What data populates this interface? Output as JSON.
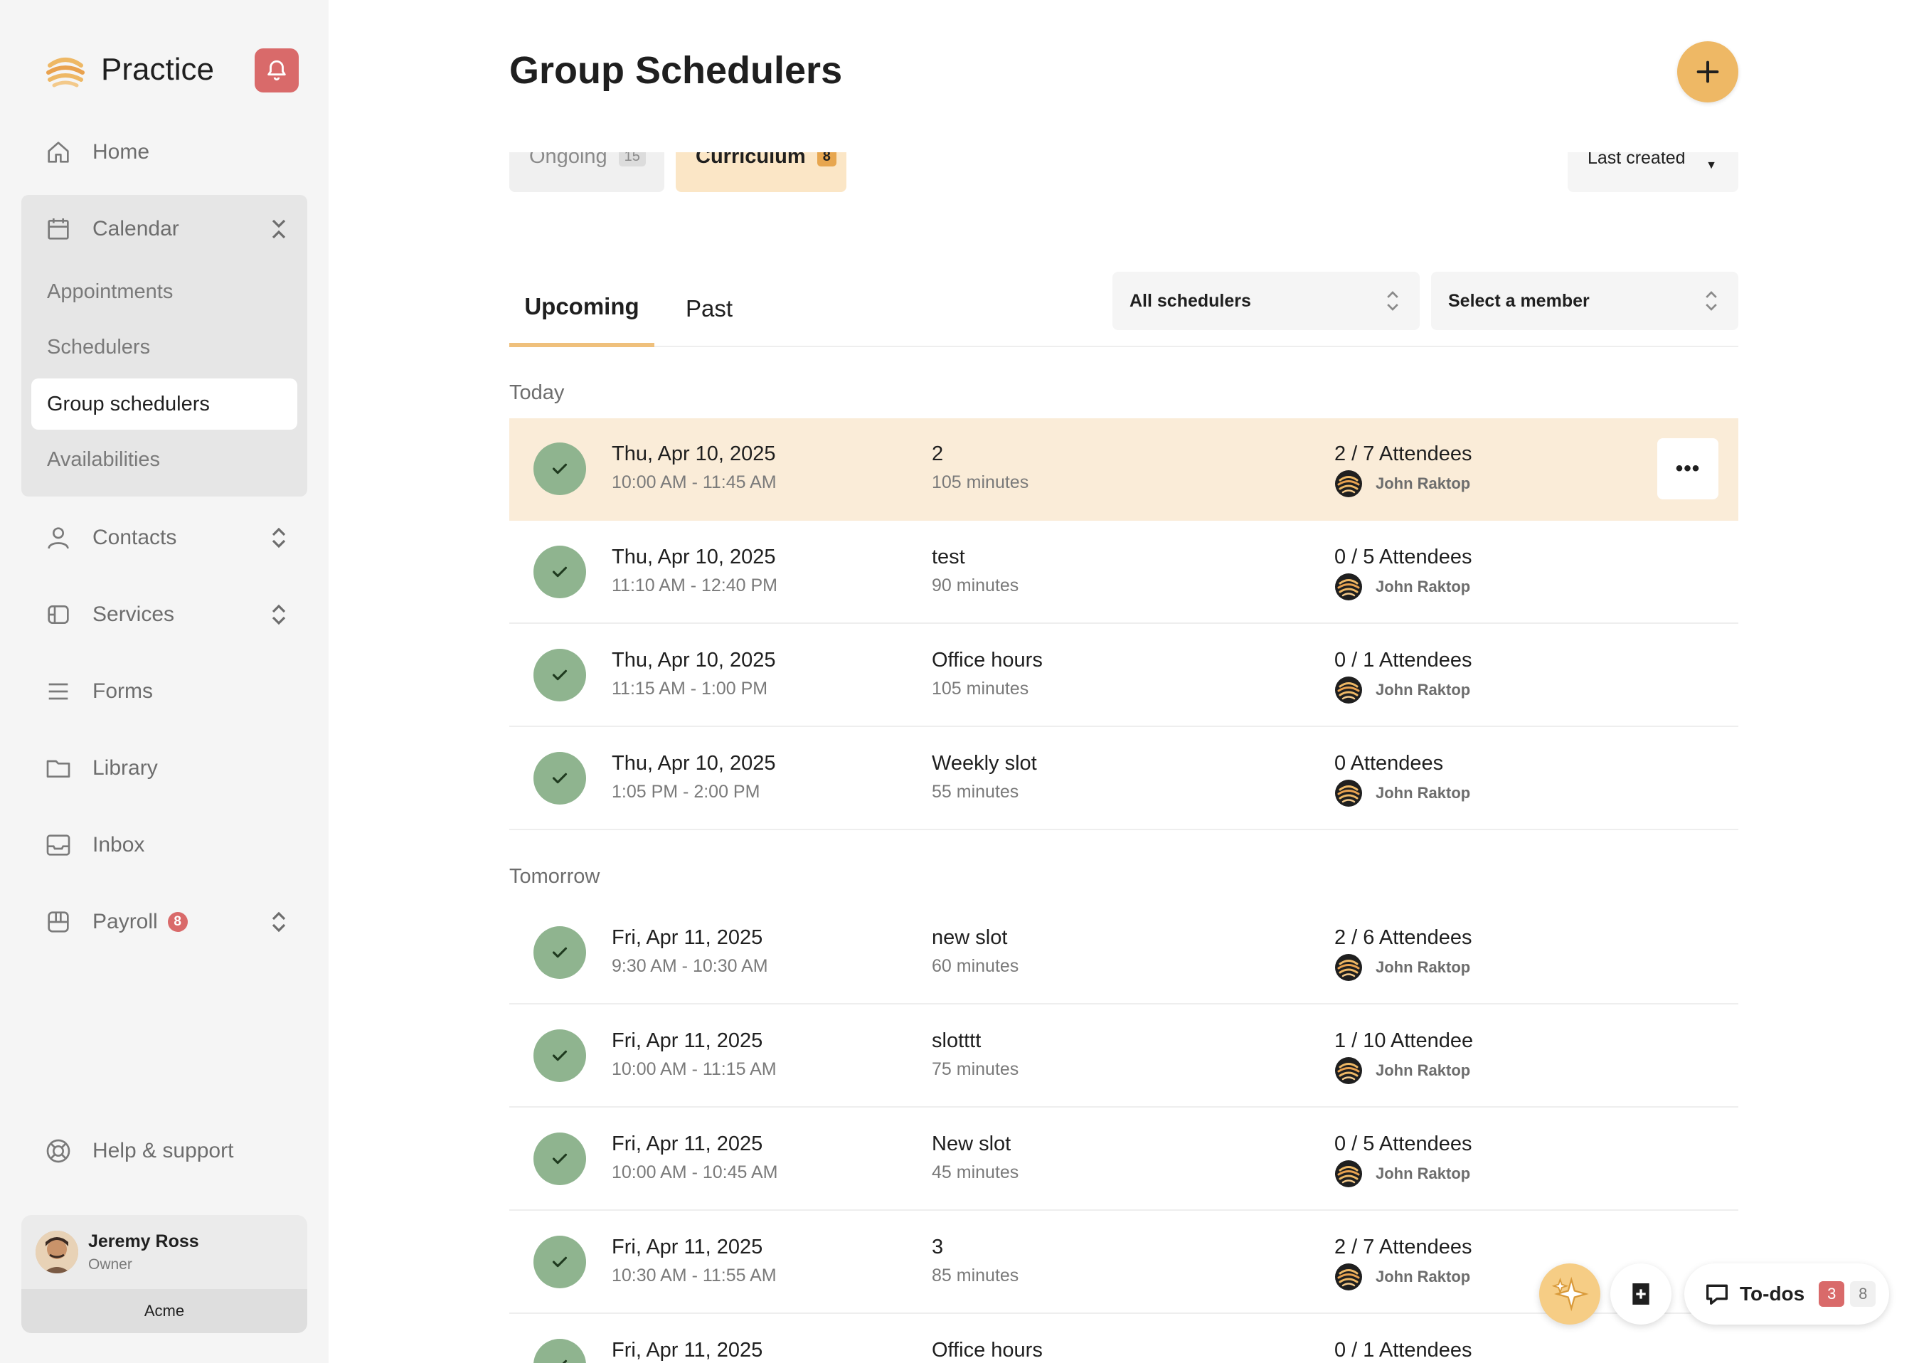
{
  "sidebar": {
    "brand": "Practice",
    "nav": {
      "home": "Home",
      "calendar": "Calendar",
      "contacts": "Contacts",
      "services": "Services",
      "forms": "Forms",
      "library": "Library",
      "inbox": "Inbox",
      "payroll": "Payroll",
      "payroll_badge": "8"
    },
    "calendar_sub": {
      "appointments": "Appointments",
      "schedulers": "Schedulers",
      "group_schedulers": "Group schedulers",
      "availabilities": "Availabilities"
    },
    "help": "Help & support",
    "user": {
      "name": "Jeremy Ross",
      "role": "Owner",
      "org": "Acme"
    }
  },
  "header": {
    "title": "Group Schedulers"
  },
  "filters": {
    "ongoing_label": "Ongoing",
    "ongoing_count": "15",
    "curriculum_label": "Curriculum",
    "curriculum_count": "8",
    "sort_label": "Last created",
    "scheduler_select": "All schedulers",
    "member_select": "Select a member"
  },
  "tabs": {
    "upcoming": "Upcoming",
    "past": "Past"
  },
  "sections": {
    "today": {
      "label": "Today",
      "rows": [
        {
          "date": "Thu, Apr 10, 2025",
          "time": "10:00 AM - 11:45 AM",
          "name": "2",
          "duration": "105 minutes",
          "attendees": "2 / 7 Attendees",
          "host": "John Raktop"
        },
        {
          "date": "Thu, Apr 10, 2025",
          "time": "11:10 AM - 12:40 PM",
          "name": "test",
          "duration": "90 minutes",
          "attendees": "0 / 5 Attendees",
          "host": "John Raktop"
        },
        {
          "date": "Thu, Apr 10, 2025",
          "time": "11:15 AM - 1:00 PM",
          "name": "Office hours",
          "duration": "105 minutes",
          "attendees": "0 / 1 Attendees",
          "host": "John Raktop"
        },
        {
          "date": "Thu, Apr 10, 2025",
          "time": "1:05 PM - 2:00 PM",
          "name": "Weekly slot",
          "duration": "55 minutes",
          "attendees": "0 Attendees",
          "host": "John Raktop"
        }
      ]
    },
    "tomorrow": {
      "label": "Tomorrow",
      "rows": [
        {
          "date": "Fri, Apr 11, 2025",
          "time": "9:30 AM - 10:30 AM",
          "name": "new slot",
          "duration": "60 minutes",
          "attendees": "2 / 6 Attendees",
          "host": "John Raktop"
        },
        {
          "date": "Fri, Apr 11, 2025",
          "time": "10:00 AM - 11:15 AM",
          "name": "slotttt",
          "duration": "75 minutes",
          "attendees": "1 / 10 Attendee",
          "host": "John Raktop"
        },
        {
          "date": "Fri, Apr 11, 2025",
          "time": "10:00 AM - 10:45 AM",
          "name": "New slot",
          "duration": "45 minutes",
          "attendees": "0 / 5 Attendees",
          "host": "John Raktop"
        },
        {
          "date": "Fri, Apr 11, 2025",
          "time": "10:30 AM - 11:55 AM",
          "name": "3",
          "duration": "85 minutes",
          "attendees": "2 / 7 Attendees",
          "host": "John Raktop"
        },
        {
          "date": "Fri, Apr 11, 2025",
          "time": "",
          "name": "Office hours",
          "duration": "",
          "attendees": "0 / 1 Attendees",
          "host": ""
        }
      ]
    }
  },
  "row_actions": {
    "more": "•••"
  },
  "floating": {
    "todos_label": "To-dos",
    "todos_count_red": "3",
    "todos_count_grey": "8"
  },
  "icons": {
    "brand": "brand-logo-icon",
    "bell": "bell-icon",
    "add": "plus-icon",
    "check": "check-icon",
    "ai": "sparkle-icon",
    "note": "note-add-icon",
    "todos": "chat-bubble-icon"
  },
  "colors": {
    "accent": "#eeb865",
    "highlight_row": "#faecd8",
    "check_green": "#8fb48f",
    "alert_red": "#d96a6a"
  }
}
